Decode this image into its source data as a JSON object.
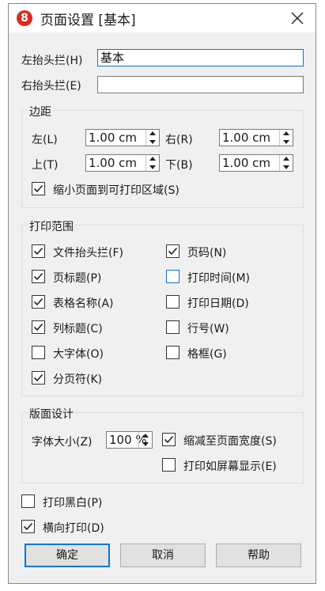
{
  "window": {
    "title": "页面设置 [基本]"
  },
  "header": {
    "left_label": "左抬头拦(H)",
    "left_value": "基本",
    "right_label": "右抬头拦(E)",
    "right_value": ""
  },
  "margins": {
    "title": "边距",
    "left_label": "左(L)",
    "left_value": "1.00 cm",
    "right_label": "右(R)",
    "right_value": "1.00 cm",
    "top_label": "上(T)",
    "top_value": "1.00 cm",
    "bottom_label": "下(B)",
    "bottom_value": "1.00 cm",
    "shrink_label": "缩小页面到可打印区域(S)",
    "shrink_checked": true
  },
  "print_range": {
    "title": "打印范围",
    "items": [
      {
        "label": "文件抬头拦(F)",
        "checked": true
      },
      {
        "label": "页码(N)",
        "checked": true
      },
      {
        "label": "页标题(P)",
        "checked": true
      },
      {
        "label": "打印时间(M)",
        "checked": false
      },
      {
        "label": "表格名称(A)",
        "checked": true
      },
      {
        "label": "打印日期(D)",
        "checked": false
      },
      {
        "label": "列标题(C)",
        "checked": true
      },
      {
        "label": "行号(W)",
        "checked": false
      },
      {
        "label": "大字体(O)",
        "checked": false
      },
      {
        "label": "格框(G)",
        "checked": false
      },
      {
        "label": "分页符(K)",
        "checked": true
      }
    ]
  },
  "layout": {
    "title": "版面设计",
    "font_size_label": "字体大小(Z)",
    "font_size_value": "100 %",
    "fit_width_label": "缩减至页面宽度(S)",
    "fit_width_checked": true,
    "screen_label": "打印如屏幕显示(E)",
    "screen_checked": false
  },
  "options": {
    "bw_label": "打印黑白(P)",
    "bw_checked": false,
    "landscape_label": "横向打印(D)",
    "landscape_checked": true
  },
  "buttons": {
    "ok": "确定",
    "cancel": "取消",
    "help": "帮助"
  },
  "colors": {
    "accent": "#0078d7",
    "logo": "#d92b1f",
    "dialog_bg": "#f0f0f0"
  }
}
